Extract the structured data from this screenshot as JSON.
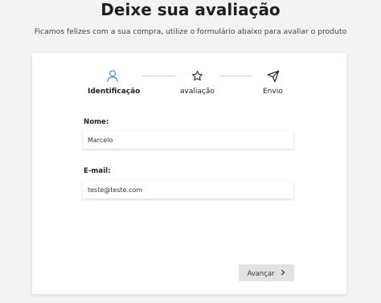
{
  "header": {
    "title": "Deixe sua avaliação",
    "subtitle": "Ficamos felizes com a sua compra, utilize o formulário abaixo para avaliar o produto"
  },
  "steps": [
    {
      "label": "Identificação",
      "icon": "user-icon",
      "active": true
    },
    {
      "label": "avaliação",
      "icon": "star-icon",
      "active": false
    },
    {
      "label": "Envio",
      "icon": "send-icon",
      "active": false
    }
  ],
  "form": {
    "name_label": "Nome:",
    "name_value": "Marcelo",
    "email_label": "E-mail:",
    "email_value": "teste@teste.com"
  },
  "actions": {
    "next_label": "Avançar",
    "next_icon": "chevron-right-icon"
  },
  "colors": {
    "active_icon": "#4a8fd4",
    "card_bg": "#ffffff",
    "page_bg": "#f3f3f3",
    "button_bg": "#e2e2e2"
  }
}
